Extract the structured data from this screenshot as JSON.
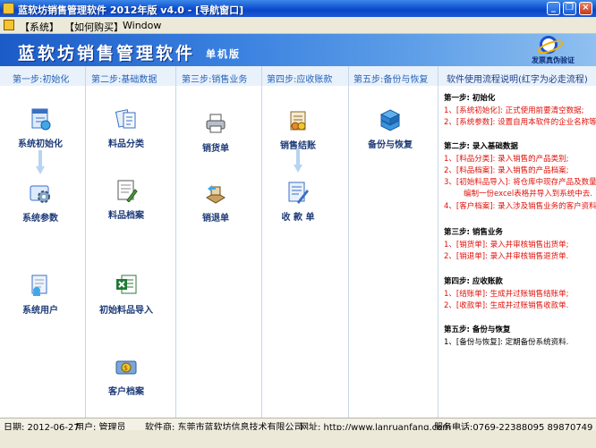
{
  "window": {
    "title": "蓝软坊销售管理软件 2012年版 v4.0 - [导航窗口]",
    "buttons": {
      "minimize": "_",
      "restore": "❐",
      "close": "×"
    }
  },
  "menu": {
    "system": "【系统】",
    "purchase": "【如何购买】",
    "window": "Window"
  },
  "banner": {
    "title": "蓝软坊销售管理软件",
    "edition": "单机版",
    "verify": "发票真伪验证"
  },
  "steps": [
    "第一步:初始化",
    "第二步:基础数据",
    "第三步:销售业务",
    "第四步:应收账款",
    "第五步:备份与恢复"
  ],
  "tools": {
    "system_init": "系统初始化",
    "system_params": "系统参数",
    "system_users": "系统用户",
    "item_category": "料品分类",
    "item_file": "料品档案",
    "initial_import": "初始料品导入",
    "customer_file": "客户档案",
    "sales_order": "销货单",
    "sales_return": "销退单",
    "sales_settle": "销售结账",
    "receipt": "收 款 单",
    "backup_restore": "备份与恢复"
  },
  "guide": {
    "title": "软件使用流程说明(红字为必走流程)",
    "s1": {
      "h": "第一步: 初始化",
      "l1": "1、[系统初始化]: 正式使用前要清空数据;",
      "l2": "2、[系统参数]: 设置自用本软件的企业名称等."
    },
    "s2": {
      "h": "第二步: 录入基础数据",
      "l1": "1、[料品分类]: 录入销售的产品类别;",
      "l2": "2、[料品档案]: 录入销售的产品档案;",
      "l3": "3、[初始料品导入]: 将仓库中现存产品及数量",
      "l3b": "编制一份excel表格并导入到系统中去.",
      "l4": "4、[客户档案]: 录入涉及销售业务的客户资料."
    },
    "s3": {
      "h": "第三步: 销售业务",
      "l1": "1、[销货单]: 录入并审核销售出货单;",
      "l2": "2、[销退单]: 录入并审核销售退货单."
    },
    "s4": {
      "h": "第四步: 应收账款",
      "l1": "1、[结账单]: 生成并过账销售结账单;",
      "l2": "2、[收款单]: 生成并过账销售收款单."
    },
    "s5": {
      "h": "第五步: 备份与恢复",
      "l1": "1、[备份与恢复]: 定期备份系统资料."
    }
  },
  "status": {
    "date": "日期: 2012-06-27",
    "user": "用户: 管理员",
    "vendor": "软件商: 东莞市蓝软坊信息技术有限公司",
    "site": "网址: http://www.lanruanfang.com",
    "phone": "服务电话:0769-22388095 89870749"
  },
  "colors": {
    "accent": "#1b5bc7",
    "step_text": "#2663b8",
    "required_text": "#e0100a",
    "tool_label": "#1d3a78"
  }
}
